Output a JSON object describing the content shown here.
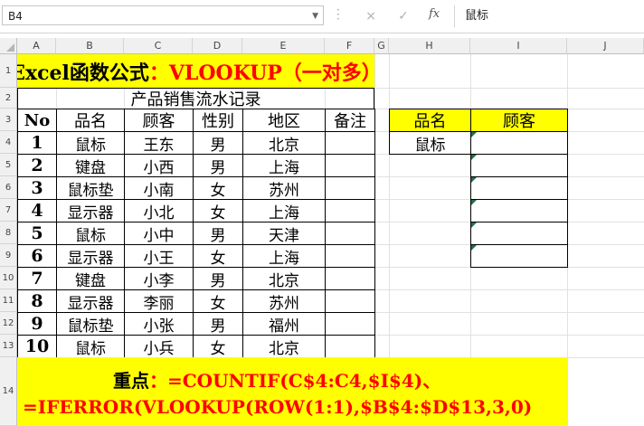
{
  "formula_bar": {
    "name_box": "B4",
    "cancel_icon": "×",
    "enter_icon": "✓",
    "fx_label": "fx",
    "value": "鼠标"
  },
  "columns": [
    "A",
    "B",
    "C",
    "D",
    "E",
    "F",
    "G",
    "H",
    "I",
    "J"
  ],
  "rows": [
    "1",
    "2",
    "3",
    "4",
    "5",
    "6",
    "7",
    "8",
    "9",
    "10",
    "11",
    "12",
    "13",
    "14"
  ],
  "title": {
    "black": "Excel函数公式",
    "red": "：VLOOKUP（一对多）"
  },
  "table": {
    "caption": "产品销售流水记录",
    "headers": [
      "No",
      "品名",
      "顾客",
      "性别",
      "地区",
      "备注"
    ],
    "rows": [
      [
        "1",
        "鼠标",
        "王东",
        "男",
        "北京",
        ""
      ],
      [
        "2",
        "键盘",
        "小西",
        "男",
        "上海",
        ""
      ],
      [
        "3",
        "鼠标垫",
        "小南",
        "女",
        "苏州",
        ""
      ],
      [
        "4",
        "显示器",
        "小北",
        "女",
        "上海",
        ""
      ],
      [
        "5",
        "鼠标",
        "小中",
        "男",
        "天津",
        ""
      ],
      [
        "6",
        "显示器",
        "小王",
        "女",
        "上海",
        ""
      ],
      [
        "7",
        "键盘",
        "小李",
        "男",
        "北京",
        ""
      ],
      [
        "8",
        "显示器",
        "李丽",
        "女",
        "苏州",
        ""
      ],
      [
        "9",
        "鼠标垫",
        "小张",
        "男",
        "福州",
        ""
      ],
      [
        "10",
        "鼠标",
        "小兵",
        "女",
        "北京",
        ""
      ]
    ]
  },
  "lookup": {
    "headers": [
      "品名",
      "顾客"
    ],
    "value": "鼠标"
  },
  "footer": {
    "line1_black": "重点",
    "line1_red": "：=COUNTIF(C$4:C4,$I$4)、",
    "line2": "=IFERROR(VLOOKUP(ROW(1:1),$B$4:$D$13,3,0)"
  },
  "colors": {
    "highlight": "#ffff00",
    "accent_red": "#ff0000",
    "header_bg": "#f0f0f0"
  }
}
